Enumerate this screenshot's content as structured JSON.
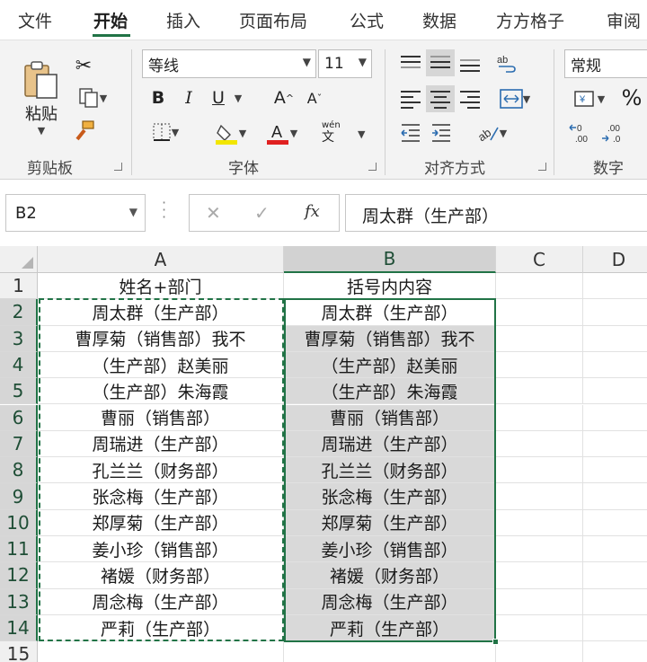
{
  "ribbon_tabs": [
    "文件",
    "开始",
    "插入",
    "页面布局",
    "公式",
    "数据",
    "方方格子",
    "审阅"
  ],
  "active_tab": "开始",
  "clipboard": {
    "paste_label": "粘贴",
    "group_label": "剪贴板"
  },
  "font": {
    "name": "等线",
    "size": "11",
    "group_label": "字体",
    "bold": "B",
    "italic": "I",
    "underline": "U",
    "grow": "A",
    "shrink": "A",
    "fill_color": "#f2e600",
    "font_color": "#e02020",
    "phonetic_top": "wén",
    "phonetic_bottom": "文"
  },
  "alignment": {
    "group_label": "对齐方式"
  },
  "number": {
    "format": "常规",
    "group_label": "数字",
    "percent": "%"
  },
  "formula_bar": {
    "name_box": "B2",
    "fx": "fx",
    "content": "周太群（生产部）"
  },
  "columns": [
    "A",
    "B",
    "C",
    "D"
  ],
  "rows": [
    "1",
    "2",
    "3",
    "4",
    "5",
    "6",
    "7",
    "8",
    "9",
    "10",
    "11",
    "12",
    "13",
    "14",
    "15"
  ],
  "headers": {
    "a": "姓名+部门",
    "b": "括号内内容"
  },
  "data_rows": [
    {
      "a": "周太群（生产部）",
      "b": "周太群（生产部）"
    },
    {
      "a": "曹厚菊（销售部）我不",
      "b": "曹厚菊（销售部）我不"
    },
    {
      "a": "（生产部）赵美丽",
      "b": "（生产部）赵美丽"
    },
    {
      "a": "（生产部）朱海霞",
      "b": "（生产部）朱海霞"
    },
    {
      "a": "曹丽（销售部）",
      "b": "曹丽（销售部）"
    },
    {
      "a": "周瑞进（生产部）",
      "b": "周瑞进（生产部）"
    },
    {
      "a": "孔兰兰（财务部）",
      "b": "孔兰兰（财务部）"
    },
    {
      "a": "张念梅（生产部）",
      "b": "张念梅（生产部）"
    },
    {
      "a": "郑厚菊（生产部）",
      "b": "郑厚菊（生产部）"
    },
    {
      "a": "姜小珍（销售部）",
      "b": "姜小珍（销售部）"
    },
    {
      "a": "褚媛（财务部）",
      "b": "褚媛（财务部）"
    },
    {
      "a": "周念梅（生产部）",
      "b": "周念梅（生产部）"
    },
    {
      "a": "严莉（生产部）",
      "b": "严莉（生产部）"
    }
  ],
  "accent": "#217346"
}
